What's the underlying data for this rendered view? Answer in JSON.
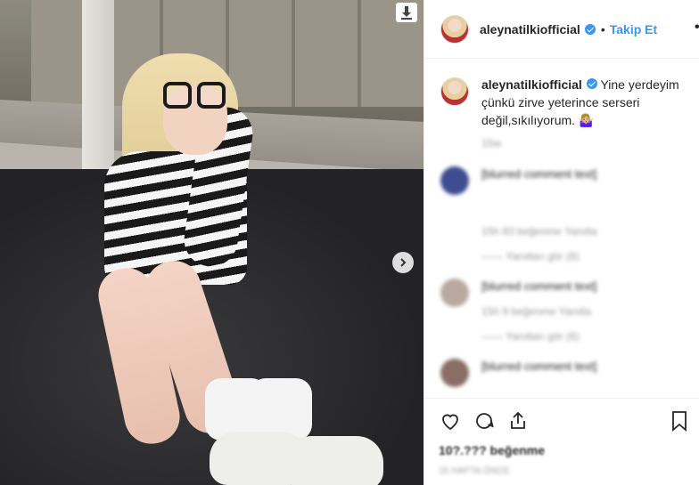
{
  "post": {
    "username": "aleynatilkiofficial",
    "follow_label": "Takip Et",
    "separator": "•",
    "more": "•"
  },
  "caption": {
    "username": "aleynatilkiofficial",
    "text": "Yine yerdeyim çünkü zirve yeterince serseri değil,sıkılıyorum. 🤷🏼‍♀️",
    "time": "15w"
  },
  "comments": [
    {
      "text": "[blurred comment text]",
      "meta": "15h  83 beğenme  Yanıtla",
      "replies": "—— Yanıtları gör (8)",
      "avatar_color": "#3d4d8f"
    },
    {
      "text": "[blurred comment text]",
      "meta": "15h  9 beğenme  Yanıtla",
      "replies": "—— Yanıtları gör (6)",
      "avatar_color": "#b9a9a0"
    },
    {
      "text": "[blurred comment text]",
      "meta": "",
      "replies": "",
      "avatar_color": "#8a6e66"
    }
  ],
  "actions": {
    "likes": "10?.??? beğenme",
    "time": "15 HAFTA ÖNCE"
  },
  "photo": {
    "download_icon": "download-icon",
    "next_icon": "chevron-right-icon"
  },
  "colors": {
    "accent": "#3897f0",
    "text": "#262626",
    "muted": "#999999"
  }
}
